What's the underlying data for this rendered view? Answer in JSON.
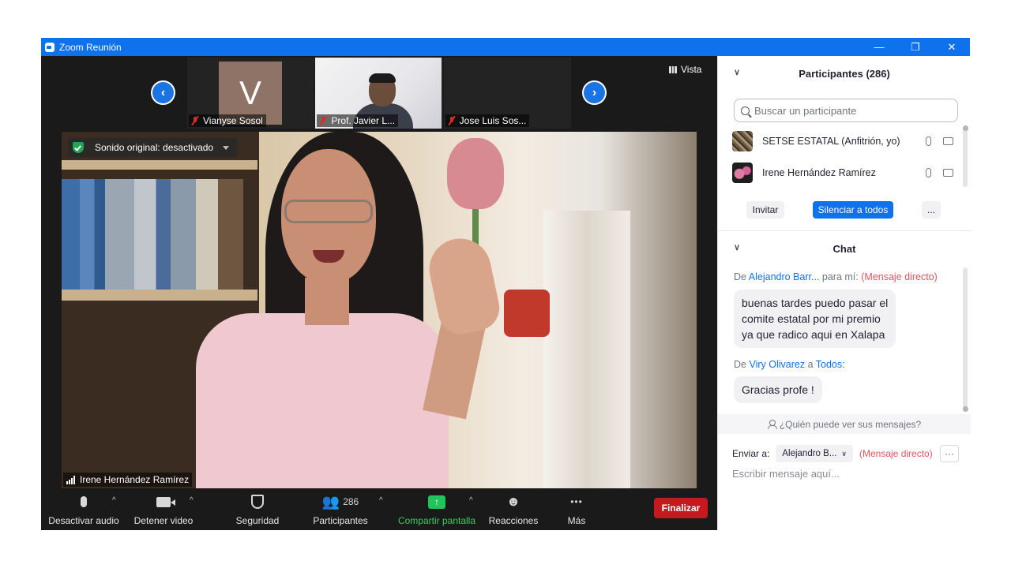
{
  "window": {
    "title": "Zoom Reunión",
    "minimize": "—",
    "restore": "❐",
    "close": "✕"
  },
  "thumbnails": {
    "prev_icon": "‹",
    "next_icon": "›",
    "items": [
      {
        "name": "Vianyse Sosol",
        "avatar_letter": "V",
        "muted": true
      },
      {
        "name": "Prof. Javier L...",
        "muted": true
      },
      {
        "name": "Jose Luis Sos...",
        "muted": true
      }
    ]
  },
  "view": {
    "label": "Vista"
  },
  "main_video": {
    "sound_label": "Sonido original: desactivado",
    "speaker_name": "Irene Hernández Ramírez"
  },
  "toolbar": {
    "audio": "Desactivar audio",
    "video": "Detener video",
    "security": "Seguridad",
    "participants": "Participantes",
    "participants_count": "286",
    "share": "Compartir pantalla",
    "share_icon": "↑",
    "reactions": "Reacciones",
    "reactions_icon": "☻",
    "more": "Más",
    "more_icon": "•••",
    "caret": "^",
    "end": "Finalizar"
  },
  "participants_panel": {
    "title": "Participantes (286)",
    "collapse_icon": "∨",
    "search_placeholder": "Buscar un participante",
    "rows": [
      {
        "name": "SETSE ESTATAL (Anfitrión, yo)"
      },
      {
        "name": "Irene Hernández Ramírez"
      }
    ],
    "invite": "Invitar",
    "mute_all": "Silenciar a todos",
    "more": "..."
  },
  "chat_panel": {
    "title": "Chat",
    "collapse_icon": "∨",
    "messages": [
      {
        "from_prefix": "De",
        "from": "Alejandro Barr...",
        "to_prefix": "para mí:",
        "tag": "(Mensaje directo)",
        "lines": [
          "buenas tardes puedo pasar el",
          "comite estatal por mi premio",
          "ya que radico aqui en Xalapa"
        ]
      },
      {
        "from_prefix": "De",
        "from": "Viry Olivarez",
        "to_prefix": "a",
        "to": "Todos:",
        "lines": [
          "Gracias profe !"
        ]
      }
    ],
    "who_sees": "¿Quién puede ver sus mensajes?",
    "send_to_label": "Enviar a:",
    "send_to_value": "Alejandro B...",
    "send_to_caret": "∨",
    "send_tag": "(Mensaje directo)",
    "more_dots": "···",
    "input_placeholder": "Escribir mensaje aquí..."
  },
  "colors": {
    "titlebar": "#0e72ed",
    "accent_blue": "#0e72ed",
    "end_red": "#c41a1f",
    "share_green": "#23c35b",
    "direct_red": "#e2545e"
  }
}
